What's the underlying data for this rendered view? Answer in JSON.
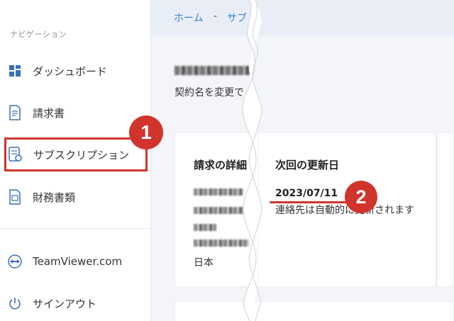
{
  "sidebar": {
    "heading": "ナビゲーション",
    "items": [
      {
        "label": "ダッシュボード",
        "icon": "dashboard-icon"
      },
      {
        "label": "請求書",
        "icon": "invoice-icon"
      },
      {
        "label": "サブスクリプション",
        "icon": "subscription-icon"
      },
      {
        "label": "財務書類",
        "icon": "documents-icon"
      },
      {
        "label": "TeamViewer.com",
        "icon": "teamviewer-icon"
      },
      {
        "label": "サインアウト",
        "icon": "power-icon"
      }
    ]
  },
  "breadcrumb": {
    "home": "ホーム",
    "separator": "-",
    "current": "サブ"
  },
  "main": {
    "subtitle": "契約名を変更で"
  },
  "billing_card": {
    "title": "請求の詳細",
    "country": "日本"
  },
  "renewal_card": {
    "title": "次回の更新日",
    "date": "2023/07/11",
    "note": "連絡先は自動的に更新されます"
  },
  "annotations": {
    "badge_1": "1",
    "badge_2": "2"
  },
  "colors": {
    "accent_red": "#d0342c",
    "link_blue": "#3b82d6"
  }
}
